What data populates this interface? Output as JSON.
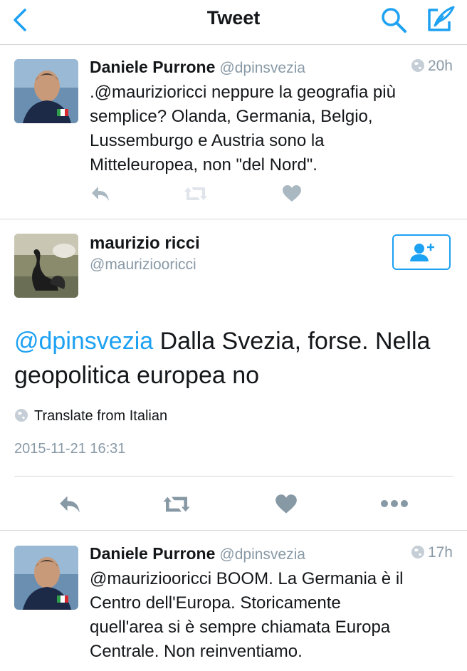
{
  "header": {
    "title": "Tweet",
    "back_icon": "chevron-left-icon",
    "search_icon": "search-icon",
    "compose_icon": "compose-feather-icon",
    "accent": "#1da1f2"
  },
  "tweets": [
    {
      "name": "Daniele Purrone",
      "handle": "@dpinsvezia",
      "time": "20h",
      "text": ".@maurizioricci neppure la geografia più\nsemplice? Olanda, Germania, Belgio,\nLussemburgo e Austria sono la\nMitteleuropea, non \"del Nord\"."
    },
    {
      "name": "Daniele Purrone",
      "handle": "@dpinsvezia",
      "time": "17h",
      "text": "@mauriziooricci BOOM. La Germania è il\nCentro dell'Europa. Storicamente\nquell'area si è sempre chiamata Europa\nCentrale. Non reinventiamo."
    }
  ],
  "focus": {
    "name": "maurizio ricci",
    "handle": "@mauriziooricci",
    "mention": "@dpinsvezia",
    "text": " Dalla Svezia, forse. Nella geopolitica europea no",
    "translate": "Translate from Italian",
    "timestamp": "2015-11-21 16:31"
  },
  "colors": {
    "text": "#14171a",
    "muted": "#8899a6",
    "divider": "#d5d8db",
    "icon_gray": "#aab8c2"
  }
}
